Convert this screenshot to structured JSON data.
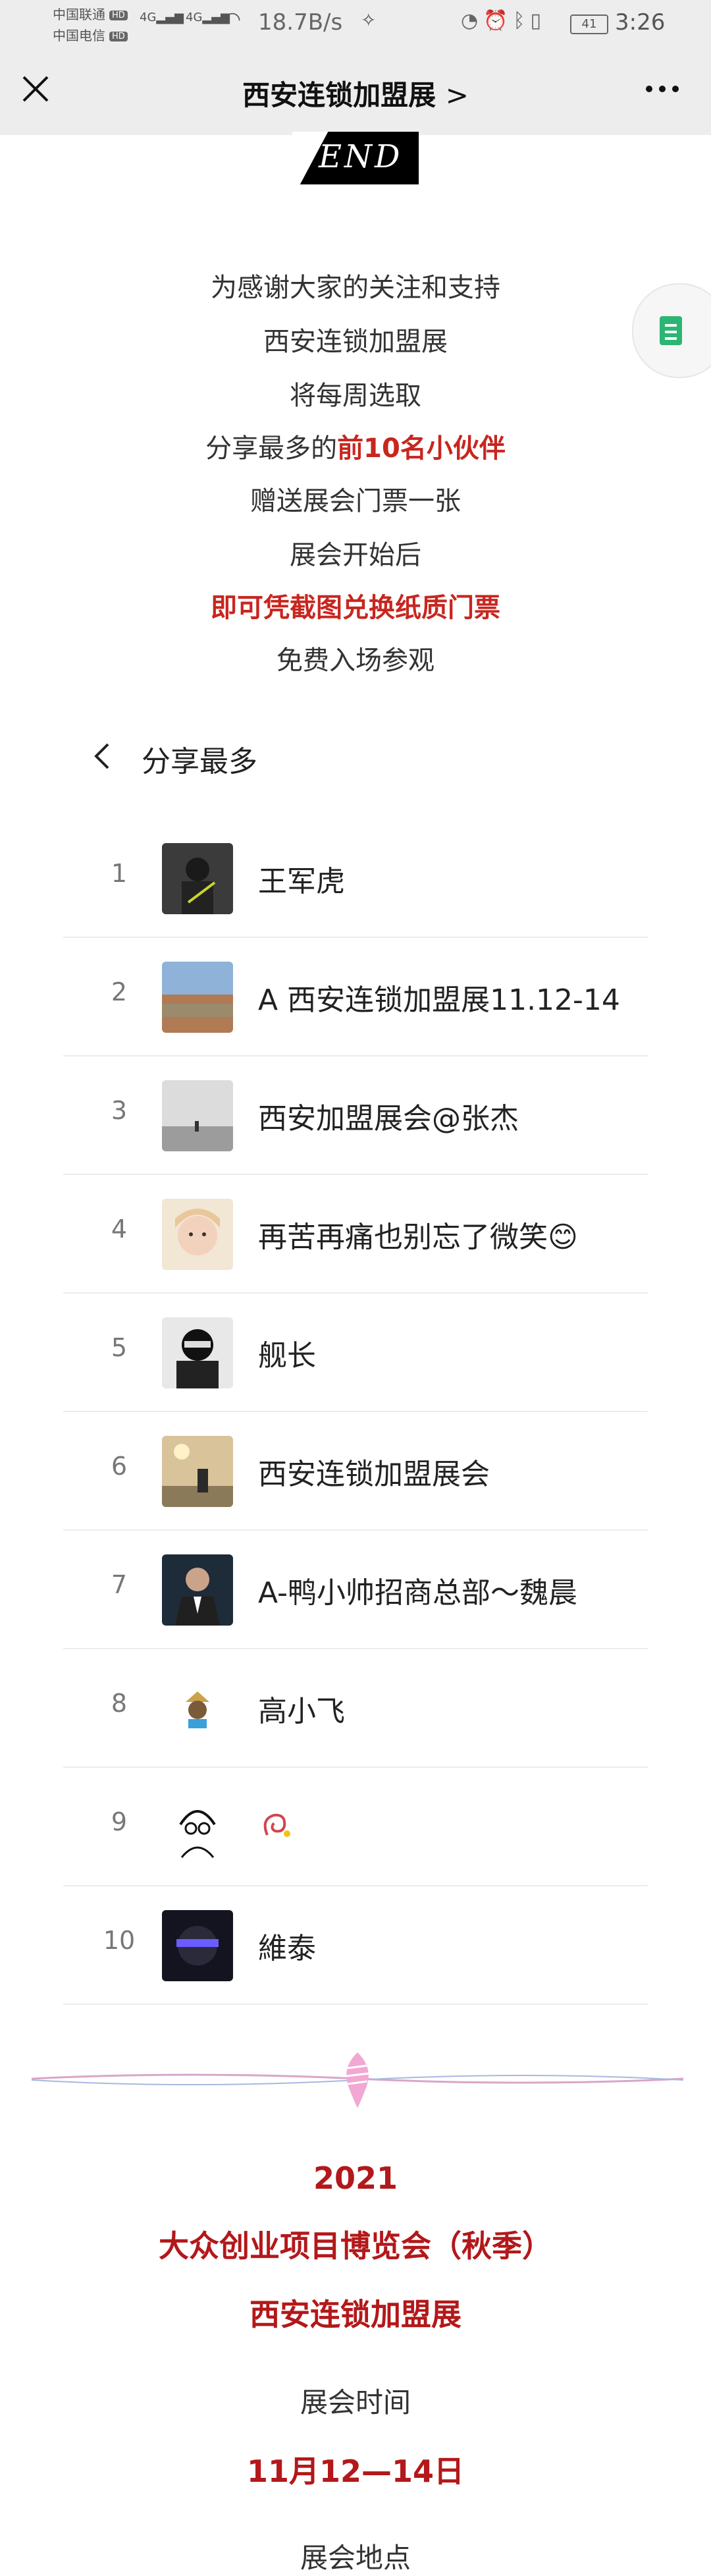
{
  "status_bar": {
    "carrier1": "中国联通",
    "carrier2": "中国电信",
    "hd": "HD",
    "net1": "4G",
    "net2": "4G",
    "net_speed": "18.7B/s",
    "battery": "41",
    "time": "3:26"
  },
  "nav": {
    "title": "西安连锁加盟展",
    "title_arrow": ">"
  },
  "end_badge": "END",
  "intro": {
    "line1": "为感谢大家的关注和支持",
    "line2": "西安连锁加盟展",
    "line3": "将每周选取",
    "line4_prefix": "分享最多的",
    "line4_highlight": "前10名小伙伴",
    "line5": "赠送展会门票一张",
    "line6": "展会开始后",
    "line7": "即可凭截图兑换纸质门票",
    "line8": "免费入场参观"
  },
  "ranking": {
    "title": "分享最多",
    "items": [
      {
        "rank": "1",
        "name": "王军虎"
      },
      {
        "rank": "2",
        "name": "A 西安连锁加盟展11.12-14"
      },
      {
        "rank": "3",
        "name": "西安加盟展会@张杰"
      },
      {
        "rank": "4",
        "name": "再苦再痛也别忘了微笑😊"
      },
      {
        "rank": "5",
        "name": "舰长"
      },
      {
        "rank": "6",
        "name": "西安连锁加盟展会"
      },
      {
        "rank": "7",
        "name": "A-鸭小帅招商总部～魏晨"
      },
      {
        "rank": "8",
        "name": "高小飞"
      },
      {
        "rank": "9",
        "name": ""
      },
      {
        "rank": "10",
        "name": "維泰"
      }
    ]
  },
  "expo": {
    "year": "2021",
    "name": "大众创业项目博览会（秋季）",
    "subtitle": "西安连锁加盟展",
    "time_label": "展会时间",
    "time_value": "11月12—14日",
    "place_label": "展会地点"
  },
  "colors": {
    "accent_red": "#c8261f",
    "expo_red": "#b3181a",
    "nav_bg": "#ededed"
  }
}
